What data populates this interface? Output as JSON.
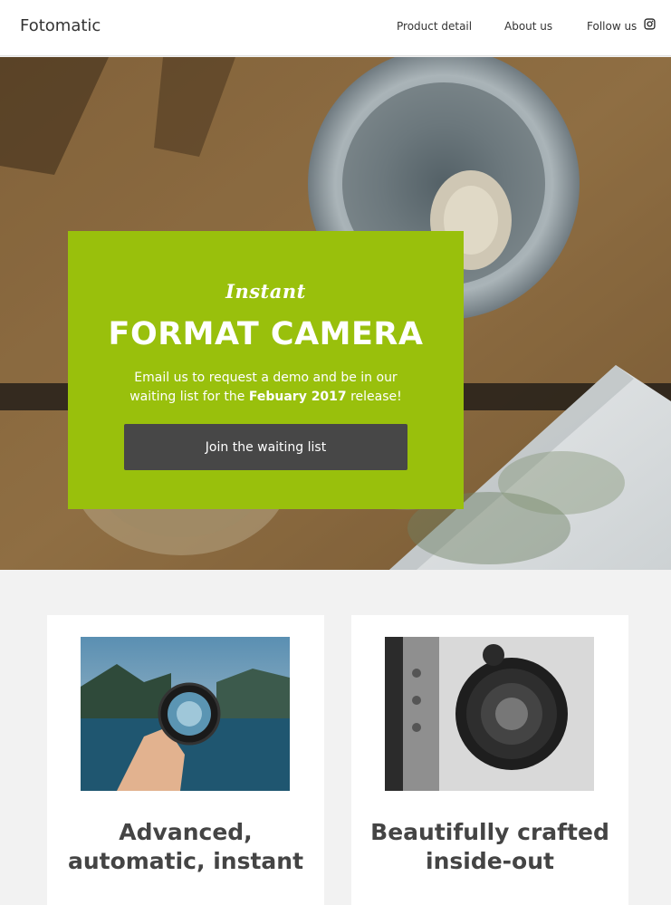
{
  "nav": {
    "brand": "Fotomatic",
    "links": [
      "Product detail",
      "About us",
      "Follow us"
    ]
  },
  "hero": {
    "kicker": "Instant",
    "title": "FORMAT CAMERA",
    "desc_before": "Email us to request a demo and be in our waiting list for the ",
    "desc_bold": "Febuary 2017",
    "desc_after": " release!",
    "cta": "Join the waiting list"
  },
  "features": [
    {
      "title": "Advanced, automatic, instant"
    },
    {
      "title": "Beautifully crafted inside-out"
    }
  ],
  "colors": {
    "accent": "#99c00c",
    "button": "#474747",
    "background": "#f2f2f2"
  }
}
